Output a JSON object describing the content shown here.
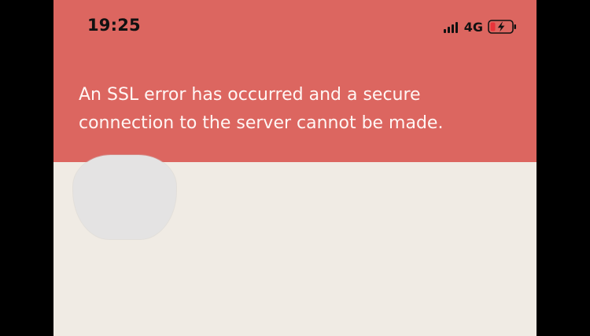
{
  "status_bar": {
    "time": "19:25",
    "network": "4G",
    "icons": [
      "signal-icon",
      "battery-charging-icon"
    ]
  },
  "error_banner": {
    "message": "An SSL error has occurred and a secure connection to the server cannot be made.",
    "color": "#dc6660"
  },
  "content": {
    "background_color": "#f0ebe4"
  }
}
